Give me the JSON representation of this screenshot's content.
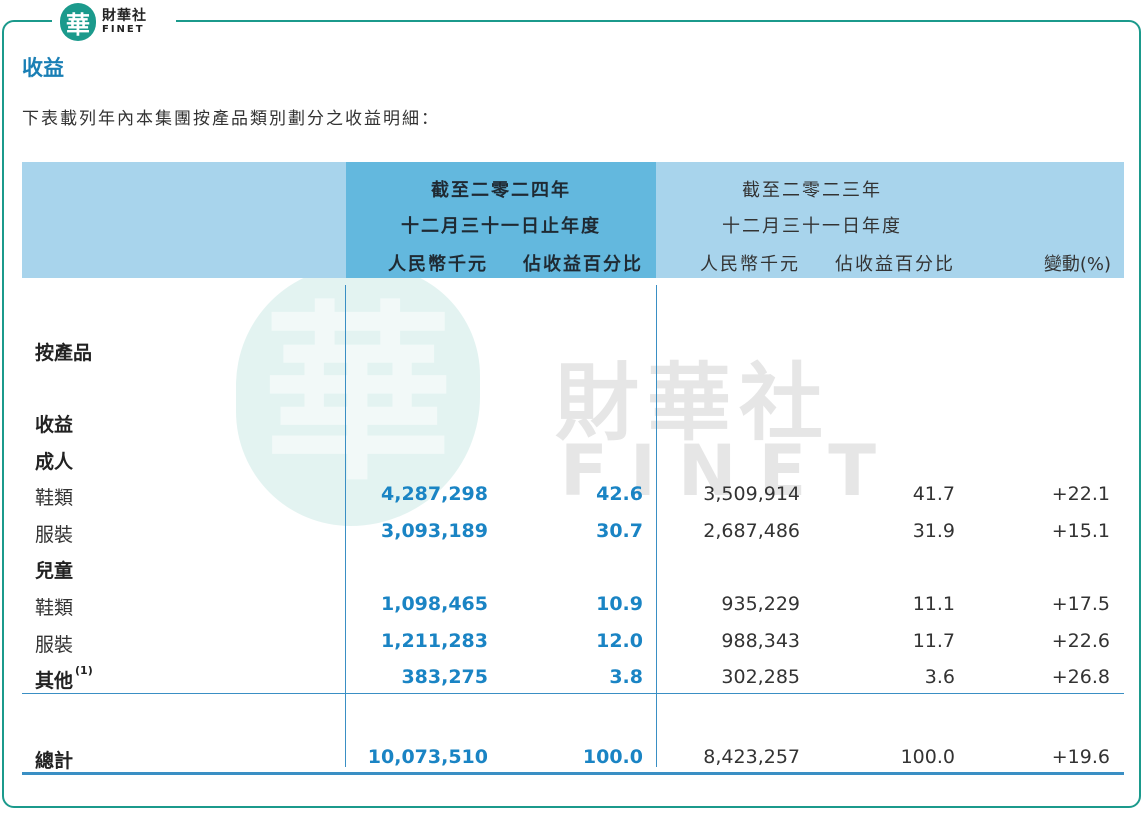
{
  "logo": {
    "badge_char": "華",
    "name_cn": "財華社",
    "name_en": "FINET"
  },
  "watermark": {
    "badge_char": "華",
    "name_cn": "財華社",
    "name_en": "FINET"
  },
  "section_title": "收益",
  "intro": "下表載列年內本集團按產品類別劃分之收益明細：",
  "header": {
    "y2024_line1": "截至二零二四年",
    "y2024_line2": "十二月三十一日止年度",
    "y2023_line1": "截至二零二三年",
    "y2023_line2": "十二月三十一日年度",
    "rmb": "人民幣千元",
    "pct": "佔收益百分比",
    "change": "變動(%)"
  },
  "rows": [
    {
      "label": "按產品",
      "bold": true
    },
    {
      "label": "收益",
      "bold": true
    },
    {
      "label": "成人",
      "bold": true
    },
    {
      "label": "鞋類",
      "v2024": "4,287,298",
      "p2024": "42.6",
      "v2023": "3,509,914",
      "p2023": "41.7",
      "change": "+22.1"
    },
    {
      "label": "服裝",
      "v2024": "3,093,189",
      "p2024": "30.7",
      "v2023": "2,687,486",
      "p2023": "31.9",
      "change": "+15.1"
    },
    {
      "label": "兒童",
      "bold": true
    },
    {
      "label": "鞋類",
      "v2024": "1,098,465",
      "p2024": "10.9",
      "v2023": "935,229",
      "p2023": "11.1",
      "change": "+17.5"
    },
    {
      "label": "服裝",
      "v2024": "1,211,283",
      "p2024": "12.0",
      "v2023": "988,343",
      "p2023": "11.7",
      "change": "+22.6"
    },
    {
      "label": "其他",
      "note": "(1)",
      "bold": true,
      "v2024": "383,275",
      "p2024": "3.8",
      "v2023": "302,285",
      "p2023": "3.6",
      "change": "+26.8"
    }
  ],
  "total": {
    "label": "總計",
    "v2024": "10,073,510",
    "p2024": "100.0",
    "v2023": "8,423,257",
    "p2023": "100.0",
    "change": "+19.6"
  }
}
